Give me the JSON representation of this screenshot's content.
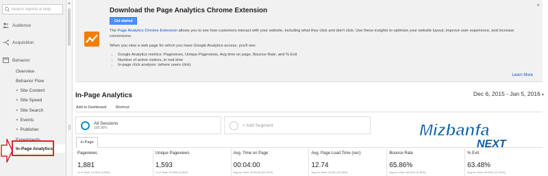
{
  "sidebar": {
    "search_placeholder": "Search reports & help",
    "sections": [
      {
        "label": "Audience",
        "icon": "audience-icon"
      },
      {
        "label": "Acquisition",
        "icon": "acquisition-icon"
      },
      {
        "label": "Behavior",
        "icon": "behavior-icon"
      }
    ],
    "behavior_items": {
      "overview": "Overview",
      "behavior_flow": "Behavior Flow",
      "site_content": "Site Content",
      "site_speed": "Site Speed",
      "site_search": "Site Search",
      "events": "Events",
      "publisher": "Publisher",
      "experiments": "Experiments",
      "in_page_analytics": "In-Page Analytics"
    },
    "caret": "▸"
  },
  "banner": {
    "title": "Download the Page Analytics Chrome Extension",
    "button": "Get started",
    "para1_pre": "The ",
    "para1_link": "Page Analytics Chrome Extension",
    "para1_post": " allows you to see how customers interact with your website, including what they click and don't click. Use these insights to optimize your website layout, improve user experience, and increase conversions.",
    "para2": "When you view a web page for which you have Google Analytics access, you'll see:",
    "bullets": [
      "Google Analytics metrics: Pageviews, Unique Pageviews, Avg time on page, Bounce Rate, and % Exit",
      "Number of active visitors, in real time",
      "In-page click analysis: (where users click)"
    ],
    "learn_more": "Learn More",
    "close": "×"
  },
  "main": {
    "title": "In-Page Analytics",
    "date_range": "Dec 6, 2015 - Jan 5, 2016",
    "date_caret": "▾",
    "actions": {
      "add_to_dashboard": "Add to Dashboard",
      "shortcut": "Shortcut"
    },
    "segments": {
      "all_sessions": "All Sessions",
      "all_sessions_pct": "100.00%",
      "add_segment": "+ Add Segment"
    },
    "tab": "In-Page",
    "metrics": [
      {
        "label": "Pageviews",
        "value": "1,881",
        "sub": "% of Total: 31.36% (5,998)"
      },
      {
        "label": "Unique Pageviews",
        "value": "1,593",
        "sub": "% of Total: 32.46% (4,909)"
      },
      {
        "label": "Avg. Time on Page",
        "value": "00:04:00",
        "sub": "Avg for View: 00:02:39 (51.22%)"
      },
      {
        "label": "Avg. Page Load Time (sec)",
        "value": "12.74",
        "sub": "Avg for View: 16.53 (-22.98%)"
      },
      {
        "label": "Bounce Rate",
        "value": "65.86%",
        "sub": "Avg for View: 65.62% (0.36%)"
      },
      {
        "label": "% Exit",
        "value": "63.48%",
        "sub": "Avg for View: 49.99% (27.00%)"
      }
    ]
  },
  "watermark": {
    "brand": "Mizbanfa",
    "sub": "NEXT"
  },
  "colors": {
    "accent_blue": "#058dc7",
    "highlight_red": "#d9232d",
    "brand_orange": "#f57c00",
    "watermark_blue": "#0b5fa8"
  }
}
